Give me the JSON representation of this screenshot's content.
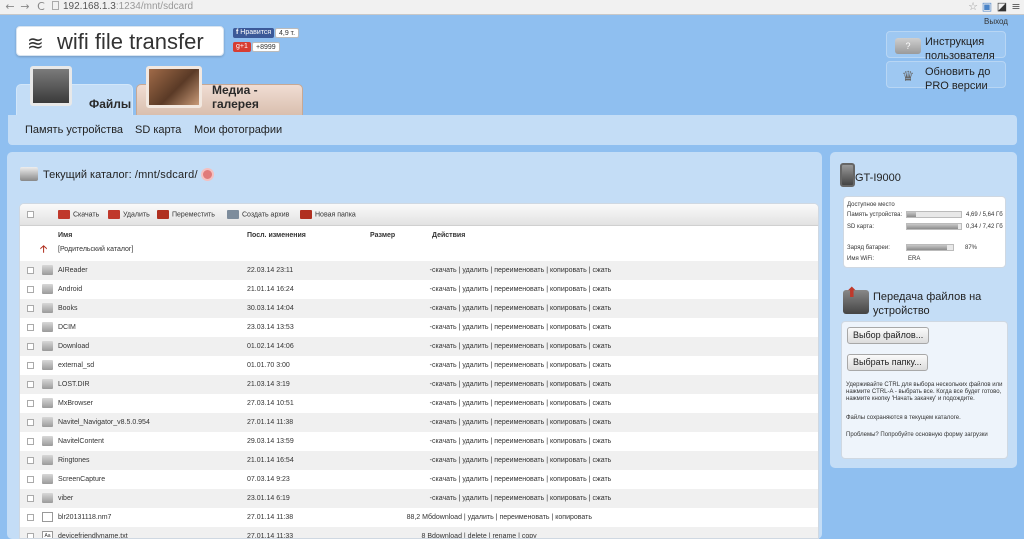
{
  "browser": {
    "back_icon": "back-arrow-icon",
    "forward_icon": "forward-arrow-icon",
    "reload_icon": "reload-icon",
    "url_host": "192.168.1.3",
    "url_rest": ":1234/mnt/sdcard"
  },
  "header": {
    "app_title": "wifi file transfer",
    "fb_label": "Нравится",
    "fb_count": "4,9 т.",
    "gplus_label": "g+1",
    "gplus_count": "+8999",
    "logout": "Выход",
    "manual_label": "Инструкция пользователя",
    "pro_label": "Обновить до PRO версии"
  },
  "tabs": [
    {
      "label": "Файлы"
    },
    {
      "label": "Медиа - галерея"
    }
  ],
  "subnav": [
    "Память устройства",
    "SD карта",
    "Мои фотографии"
  ],
  "main": {
    "current_catalog_label": "Текущий каталог:",
    "current_path": "/mnt/sdcard/",
    "toolbar": {
      "download": "Скачать",
      "delete": "Удалить",
      "move": "Переместить",
      "archive": "Создать архив",
      "new_folder": "Новая папка"
    },
    "columns": {
      "name": "Имя",
      "modified": "Посл. изменения",
      "size": "Размер",
      "actions": "Действия"
    },
    "parent_label": "[Родительский каталог]",
    "files": [
      {
        "name": "AIReader",
        "date": "22.03.14 23:11",
        "size": "-",
        "type": "folder",
        "actions": "скачать | удалить | переименовать | копировать | сжать"
      },
      {
        "name": "Android",
        "date": "21.01.14 16:24",
        "size": "-",
        "type": "folder",
        "actions": "скачать | удалить | переименовать | копировать | сжать"
      },
      {
        "name": "Books",
        "date": "30.03.14 14:04",
        "size": "-",
        "type": "folder",
        "actions": "скачать | удалить | переименовать | копировать | сжать"
      },
      {
        "name": "DCIM",
        "date": "23.03.14 13:53",
        "size": "-",
        "type": "folder",
        "actions": "скачать | удалить | переименовать | копировать | сжать"
      },
      {
        "name": "Download",
        "date": "01.02.14 14:06",
        "size": "-",
        "type": "folder",
        "actions": "скачать | удалить | переименовать | копировать | сжать"
      },
      {
        "name": "external_sd",
        "date": "01.01.70 3:00",
        "size": "-",
        "type": "folder",
        "actions": "скачать | удалить | переименовать | копировать | сжать"
      },
      {
        "name": "LOST.DIR",
        "date": "21.03.14 3:19",
        "size": "-",
        "type": "folder",
        "actions": "скачать | удалить | переименовать | копировать | сжать"
      },
      {
        "name": "MxBrowser",
        "date": "27.03.14 10:51",
        "size": "-",
        "type": "folder",
        "actions": "скачать | удалить | переименовать | копировать | сжать"
      },
      {
        "name": "Navitel_Navigator_v8.5.0.954",
        "date": "27.01.14 11:38",
        "size": "-",
        "type": "folder",
        "actions": "скачать | удалить | переименовать | копировать | сжать"
      },
      {
        "name": "NavitelContent",
        "date": "29.03.14 13:59",
        "size": "-",
        "type": "folder",
        "actions": "скачать | удалить | переименовать | копировать | сжать"
      },
      {
        "name": "Ringtones",
        "date": "21.01.14 16:54",
        "size": "-",
        "type": "folder",
        "actions": "скачать | удалить | переименовать | копировать | сжать"
      },
      {
        "name": "ScreenCapture",
        "date": "07.03.14 9:23",
        "size": "-",
        "type": "folder",
        "actions": "скачать | удалить | переименовать | копировать | сжать"
      },
      {
        "name": "viber",
        "date": "23.01.14 6:19",
        "size": "-",
        "type": "folder",
        "actions": "скачать | удалить | переименовать | копировать | сжать"
      },
      {
        "name": "blr20131118.nm7",
        "date": "27.01.14 11:38",
        "size": "88,2 Мб",
        "type": "file",
        "actions": "download | удалить | переименовать | копировать"
      },
      {
        "name": "devicefriendlyname.txt",
        "date": "27.01.14 11:33",
        "size": "8 B",
        "type": "text",
        "actions": "download | delete | rename | copy"
      }
    ]
  },
  "side": {
    "device_name": "GT-I9000",
    "free_space_label": "Доступное место",
    "device_mem_label": "Память устройства:",
    "device_mem_value": "4,69 / 5,64 Гб",
    "device_mem_fraction": 0.17,
    "sd_label": "SD карта:",
    "sd_value": "0,34 / 7,42 Гб",
    "sd_fraction": 0.95,
    "battery_label": "Заряд батареи:",
    "battery_value": "87%",
    "battery_fraction": 0.87,
    "wifi_label": "Имя WiFi:",
    "wifi_value": "ERA",
    "upload_title": "Передача файлов на устройство",
    "choose_files": "Выбор файлов...",
    "choose_folder": "Выбрать папку...",
    "hint1": "Удерживайте CTRL для выбора нескольких файлов или нажмите CTRL-A - выбрать все. Когда все будет готово, нажмите кнопку 'Начать закачку' и подождите.",
    "hint2": "Файлы сохраняются в текущем каталоге.",
    "hint3": "Проблемы? Попробуйте основную форму загрузки"
  },
  "colors": {
    "background": "#8fbff0",
    "panel": "#c4ddf6",
    "table_alt_row": "#f0f0f0",
    "fb": "#3b5998",
    "gplus": "#d73d32"
  }
}
